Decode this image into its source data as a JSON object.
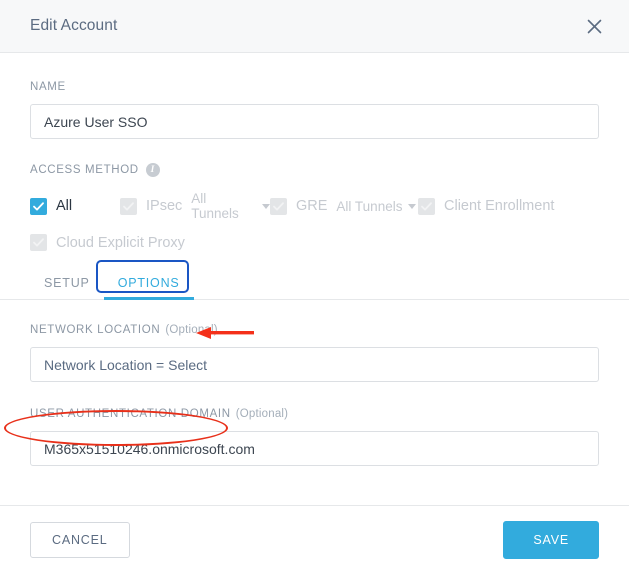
{
  "header": {
    "title": "Edit Account",
    "close_icon": "close-icon"
  },
  "form": {
    "name": {
      "label": "NAME",
      "value": "Azure User SSO",
      "placeholder": ""
    },
    "access_method": {
      "label": "ACCESS METHOD",
      "info_icon": "info-icon",
      "info_glyph": "i",
      "options": [
        {
          "label": "All",
          "checked": true,
          "enabled": true,
          "dropdown": null
        },
        {
          "label": "IPsec",
          "checked": true,
          "enabled": false,
          "dropdown": "All Tunnels"
        },
        {
          "label": "GRE",
          "checked": true,
          "enabled": false,
          "dropdown": "All Tunnels"
        },
        {
          "label": "Client Enrollment",
          "checked": true,
          "enabled": false,
          "dropdown": null
        },
        {
          "label": "Cloud Explicit Proxy",
          "checked": true,
          "enabled": false,
          "dropdown": null
        }
      ]
    },
    "network_location": {
      "label": "NETWORK LOCATION",
      "optional": "(Optional)",
      "value": "Network Location = Select",
      "placeholder": "Network Location = Select"
    },
    "user_auth_domain": {
      "label": "USER AUTHENTICATION DOMAIN",
      "optional": "(Optional)",
      "value": "M365x51510246.onmicrosoft.com",
      "placeholder": ""
    }
  },
  "tabs": [
    {
      "label": "SETUP",
      "active": false
    },
    {
      "label": "OPTIONS",
      "active": true
    }
  ],
  "footer": {
    "cancel_label": "CANCEL",
    "save_label": "SAVE"
  },
  "annotations": {
    "arrow_icon": "red-left-arrow-icon",
    "tab_highlight": "blue-rectangle-highlight",
    "domain_highlight": "red-ellipse-highlight"
  },
  "colors": {
    "accent": "#32abdd",
    "annotation_red": "#e8301a",
    "annotation_blue": "#1a56c4",
    "header_bg": "#f7f8f9",
    "label_gray": "#8d98a5",
    "disabled_gray": "#c6cad0"
  }
}
